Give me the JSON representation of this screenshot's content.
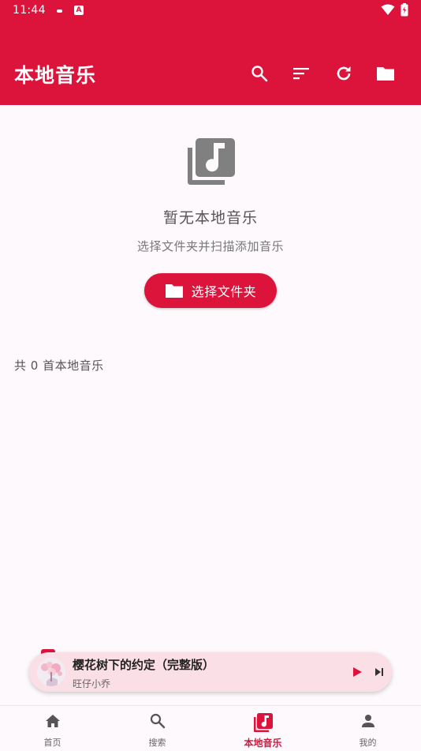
{
  "status_bar": {
    "time": "11:44",
    "notification_letter": "A"
  },
  "header": {
    "title": "本地音乐",
    "actions": [
      {
        "icon": "search-icon"
      },
      {
        "icon": "sort-icon"
      },
      {
        "icon": "refresh-icon"
      },
      {
        "icon": "folder-icon"
      }
    ]
  },
  "empty_state": {
    "icon": "music-library-icon",
    "title": "暂无本地音乐",
    "subtitle": "选择文件夹并扫描添加音乐",
    "button_label": "选择文件夹",
    "button_icon": "folder-icon"
  },
  "count_label": "共 0 首本地音乐",
  "mini_player": {
    "track_title": "樱花树下的约定（完整版）",
    "artist": "旺仔小乔",
    "is_playing": false
  },
  "bottom_nav": {
    "items": [
      {
        "label": "首页",
        "icon": "home-icon",
        "active": false
      },
      {
        "label": "搜索",
        "icon": "search-icon",
        "active": false
      },
      {
        "label": "本地音乐",
        "icon": "music-library-icon",
        "active": true
      },
      {
        "label": "我的",
        "icon": "person-icon",
        "active": false
      }
    ]
  },
  "colors": {
    "primary": "#dc143c",
    "background": "#fdf9fc",
    "mini_player_bg": "#fbdfe6",
    "icon_gray": "#808080"
  }
}
